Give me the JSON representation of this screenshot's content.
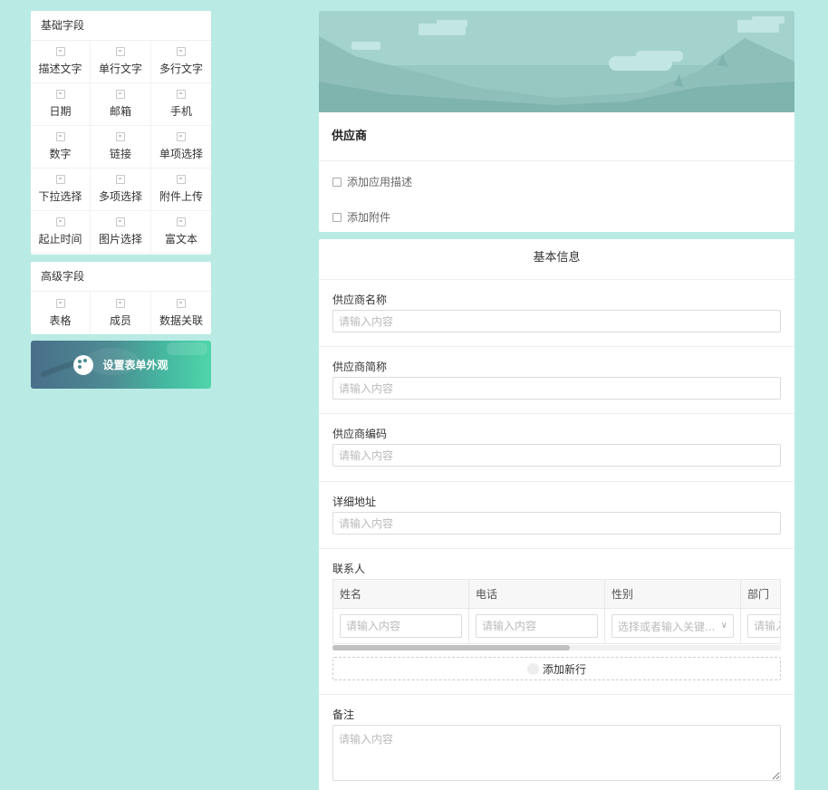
{
  "sidebar": {
    "basic": {
      "title": "基础字段",
      "items": [
        {
          "label": "描述文字",
          "icon": "description-icon"
        },
        {
          "label": "单行文字",
          "icon": "single-line-icon"
        },
        {
          "label": "多行文字",
          "icon": "multi-line-icon"
        },
        {
          "label": "日期",
          "icon": "date-icon"
        },
        {
          "label": "邮箱",
          "icon": "email-icon"
        },
        {
          "label": "手机",
          "icon": "phone-icon"
        },
        {
          "label": "数字",
          "icon": "number-icon"
        },
        {
          "label": "链接",
          "icon": "link-icon"
        },
        {
          "label": "单项选择",
          "icon": "radio-icon"
        },
        {
          "label": "下拉选择",
          "icon": "dropdown-icon"
        },
        {
          "label": "多项选择",
          "icon": "checkbox-icon"
        },
        {
          "label": "附件上传",
          "icon": "attachment-icon"
        },
        {
          "label": "起止时间",
          "icon": "time-range-icon"
        },
        {
          "label": "图片选择",
          "icon": "image-icon"
        },
        {
          "label": "富文本",
          "icon": "rich-text-icon"
        }
      ]
    },
    "advanced": {
      "title": "高级字段",
      "items": [
        {
          "label": "表格",
          "icon": "table-icon"
        },
        {
          "label": "成员",
          "icon": "member-icon"
        },
        {
          "label": "数据关联",
          "icon": "data-link-icon"
        }
      ]
    },
    "appearance_button": "设置表单外观"
  },
  "header": {
    "form_title": "供应商",
    "add_description": "添加应用描述",
    "add_attachment": "添加附件"
  },
  "section": {
    "title": "基本信息",
    "fields": [
      {
        "label": "供应商名称",
        "placeholder": "请输入内容"
      },
      {
        "label": "供应商简称",
        "placeholder": "请输入内容"
      },
      {
        "label": "供应商编码",
        "placeholder": "请输入内容"
      },
      {
        "label": "详细地址",
        "placeholder": "请输入内容"
      }
    ],
    "contacts": {
      "label": "联系人",
      "columns": [
        "姓名",
        "电话",
        "性别",
        "部门"
      ],
      "row": {
        "name_placeholder": "请输入内容",
        "phone_placeholder": "请输入内容",
        "gender_placeholder": "选择或者输入关键...",
        "dept_placeholder": "请输入内容"
      },
      "add_row": "添加新行"
    },
    "remarks": {
      "label": "备注",
      "placeholder": "请输入内容"
    }
  },
  "colors": {
    "background": "#b9ebe4",
    "banner_sky": "#9fcfca",
    "banner_hills": "#86b8b2"
  }
}
